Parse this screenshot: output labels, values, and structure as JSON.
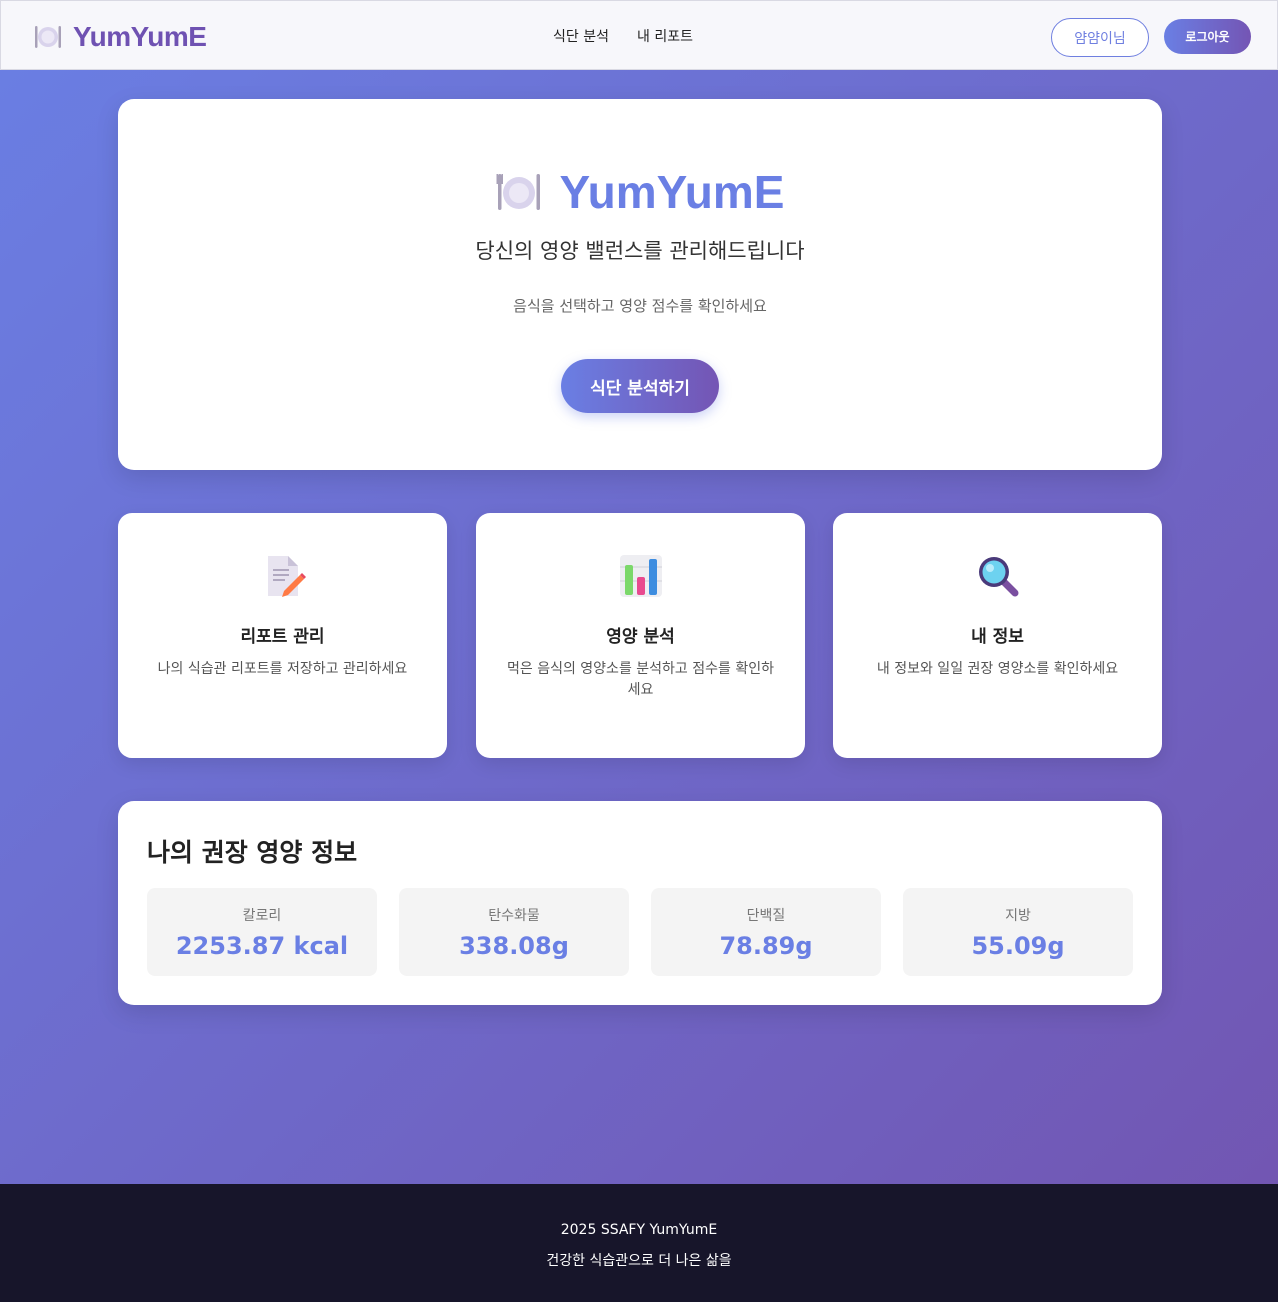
{
  "header": {
    "logo_text": "YumYumE",
    "logo_icon": "plate-cutlery-icon",
    "nav": [
      "식단 분석",
      "내 리포트"
    ],
    "user_button": "얌얌이님",
    "logout_button": "로그아웃"
  },
  "hero": {
    "icon": "plate-cutlery-icon",
    "title": "YumYumE",
    "subtitle": "당신의 영양 밸런스를 관리해드립니다",
    "description": "음식을 선택하고 영양 점수를 확인하세요",
    "cta": "식단 분석하기"
  },
  "features": [
    {
      "icon": "memo-icon",
      "title": "리포트 관리",
      "description": "나의 식습관 리포트를 저장하고 관리하세요"
    },
    {
      "icon": "bar-chart-icon",
      "title": "영양 분석",
      "description": "먹은 음식의 영양소를 분석하고 점수를 확인하세요"
    },
    {
      "icon": "magnifier-icon",
      "title": "내 정보",
      "description": "내 정보와 일일 권장 영양소를 확인하세요"
    }
  ],
  "nutrition": {
    "title": "나의 권장 영양 정보",
    "items": [
      {
        "label": "칼로리",
        "value": "2253.87 kcal"
      },
      {
        "label": "탄수화물",
        "value": "338.08g"
      },
      {
        "label": "단백질",
        "value": "78.89g"
      },
      {
        "label": "지방",
        "value": "55.09g"
      }
    ]
  },
  "footer": {
    "line1": "2025 SSAFY YumYumE",
    "line2": "건강한 식습관으로 더 나은 삶을"
  },
  "colors": {
    "accent": "#6a7fe4",
    "accent_dark": "#7455b4",
    "logo": "#6f52b2",
    "footer_bg": "#17152a"
  }
}
